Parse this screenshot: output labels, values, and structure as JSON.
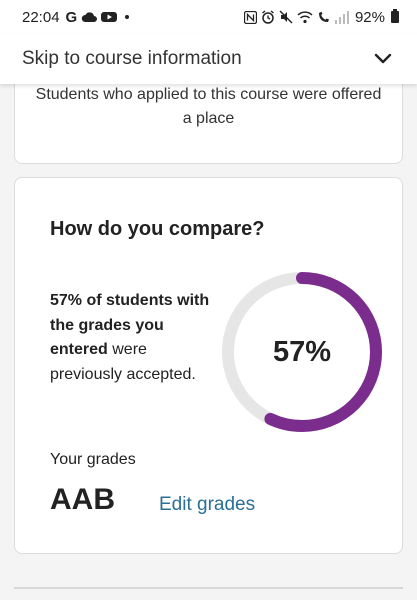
{
  "status_bar": {
    "time": "22:04",
    "battery": "92%",
    "left_icons": [
      "google-g-icon",
      "cloud-icon",
      "youtube-icon"
    ],
    "right_icons": [
      "nfc-icon",
      "alarm-icon",
      "mute-icon",
      "wifi-icon",
      "wifi-call-icon",
      "signal-icon",
      "battery-icon"
    ]
  },
  "skip_header": {
    "label": "Skip to course information"
  },
  "offer_card": {
    "text": "Students who applied to this course were offered a place"
  },
  "compare_card": {
    "title": "How do you compare?",
    "stat_bold": "57% of students with the grades you entered",
    "stat_rest": " were previously accepted.",
    "percent_label": "57%",
    "percent_value": 57,
    "grades_label": "Your grades",
    "grades_value": "AAB",
    "edit_link": "Edit grades"
  },
  "colors": {
    "accent_purple": "#7b2d8e",
    "ring_track": "#e6e6e6",
    "link_blue": "#2a6f97"
  }
}
